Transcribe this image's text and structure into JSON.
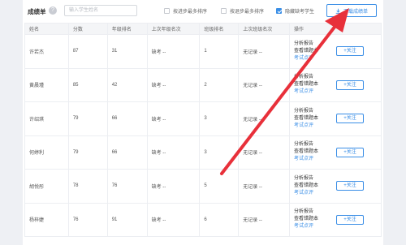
{
  "toolbar": {
    "title": "成绩单",
    "help_icon": "question-icon",
    "search_placeholder": "输入学生姓名",
    "sort_progress_label": "按进步最多排序",
    "sort_regress_label": "按退步最多排序",
    "hide_absent_label": "隐藏缺考学生",
    "hide_absent_checked": true,
    "download_label": "下载成绩单",
    "download_icon": "download-icon"
  },
  "table": {
    "headers": [
      "姓名",
      "分数",
      "年级排名",
      "上次年级名次",
      "班级排名",
      "上次班级名次",
      "操作"
    ],
    "rows": [
      {
        "name": "许若杰",
        "score": "87",
        "grade_rank": "31",
        "last_grade": "缺考 --",
        "class_rank": "1",
        "last_class": "无记录 --"
      },
      {
        "name": "黄晨瑾",
        "score": "85",
        "grade_rank": "42",
        "last_grade": "缺考 --",
        "class_rank": "2",
        "last_class": "无记录 --"
      },
      {
        "name": "许绍琪",
        "score": "79",
        "grade_rank": "66",
        "last_grade": "缺考 --",
        "class_rank": "3",
        "last_class": "无记录 --"
      },
      {
        "name": "何婷利",
        "score": "79",
        "grade_rank": "66",
        "last_grade": "缺考 --",
        "class_rank": "3",
        "last_class": "无记录 --"
      },
      {
        "name": "胡悦彤",
        "score": "78",
        "grade_rank": "76",
        "last_grade": "缺考 --",
        "class_rank": "5",
        "last_class": "无记录 --"
      },
      {
        "name": "杨梓婕",
        "score": "76",
        "grade_rank": "91",
        "last_grade": "缺考 --",
        "class_rank": "6",
        "last_class": "无记录 --"
      }
    ],
    "ops": {
      "report": "分析报告",
      "wrongbook": "查看错题本",
      "comment": "考试点评",
      "follow": "+关注"
    }
  },
  "colors": {
    "accent": "#3a8ee6",
    "arrow": "#e8303a"
  }
}
